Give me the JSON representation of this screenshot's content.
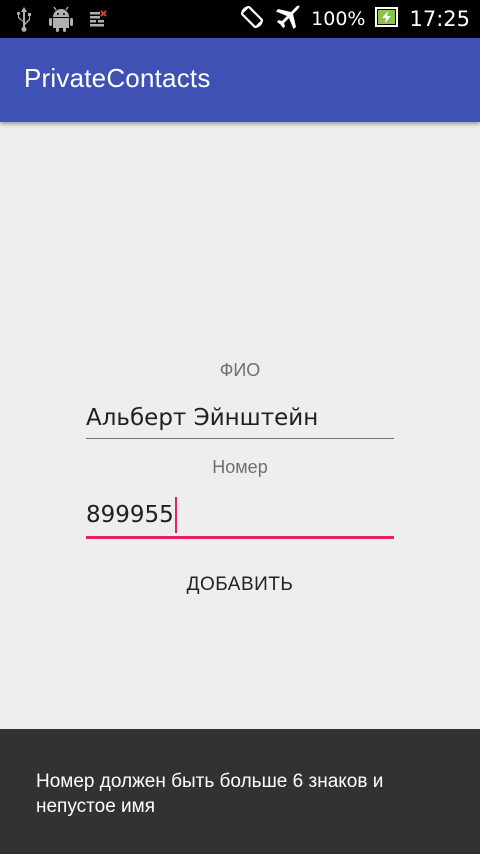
{
  "status_bar": {
    "battery": "100%",
    "time": "17:25",
    "icons": [
      "usb-icon",
      "android-debug-icon",
      "sim-icon",
      "rotate-icon",
      "airplane-icon",
      "battery-charging-icon"
    ]
  },
  "app_bar": {
    "title": "PrivateContacts",
    "color": "#3f51b5"
  },
  "form": {
    "name_label": "ФИО",
    "name_value": "Альберт Эйнштейн",
    "number_label": "Номер",
    "number_value": "899955",
    "add_button_label": "ДОБАВИТЬ",
    "accent_color": "#e91e63"
  },
  "snackbar": {
    "message": "Номер должен быть больше 6 знаков и непустое имя"
  }
}
